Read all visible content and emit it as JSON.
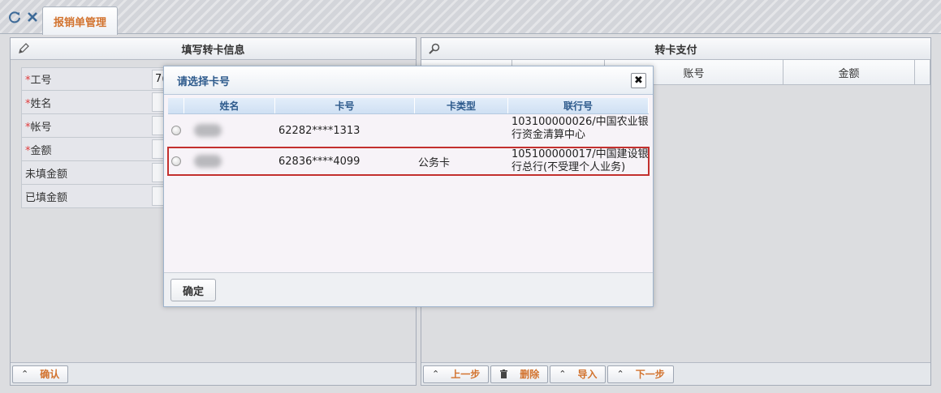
{
  "tabs": [
    {
      "label": "报销单管理",
      "active": true
    }
  ],
  "left_panel": {
    "title": "填写转卡信息",
    "fields": [
      {
        "label": "工号",
        "required": true,
        "value": "7("
      },
      {
        "label": "姓名",
        "required": true,
        "value": ""
      },
      {
        "label": "帐号",
        "required": true,
        "value": ""
      },
      {
        "label": "金额",
        "required": true,
        "value": ""
      },
      {
        "label": "未填金额",
        "required": false,
        "value": ""
      },
      {
        "label": "已填金额",
        "required": false,
        "value": ""
      }
    ],
    "confirm_label": "确认"
  },
  "right_panel": {
    "title": "转卡支付",
    "columns": [
      "账号",
      "金额"
    ],
    "buttons": {
      "prev": "上一步",
      "delete": "删除",
      "import": "导入",
      "next": "下一步"
    }
  },
  "modal": {
    "title": "请选择卡号",
    "close_glyph": "✖",
    "columns": [
      "姓名",
      "卡号",
      "卡类型",
      "联行号"
    ],
    "rows": [
      {
        "card_no": "62282****1313",
        "card_type": "",
        "bank_line1": "103100000026/中国农业银",
        "bank_line2": "行资金清算中心",
        "selected": false
      },
      {
        "card_no": "62836****4099",
        "card_type": "公务卡",
        "bank_line1": "105100000017/中国建设银",
        "bank_line2": "行总行(不受理个人业务)",
        "selected": false,
        "highlighted": true
      }
    ],
    "ok_label": "确定"
  },
  "colors": {
    "accent_orange": "#d2722d",
    "title_blue": "#2d5a8c",
    "highlight_red": "#c3302e",
    "required_red": "#e03a3a"
  },
  "icons": [
    "refresh-icon",
    "close-icon",
    "pencil-icon",
    "search-icon",
    "chevron-up-icon",
    "trash-icon"
  ]
}
